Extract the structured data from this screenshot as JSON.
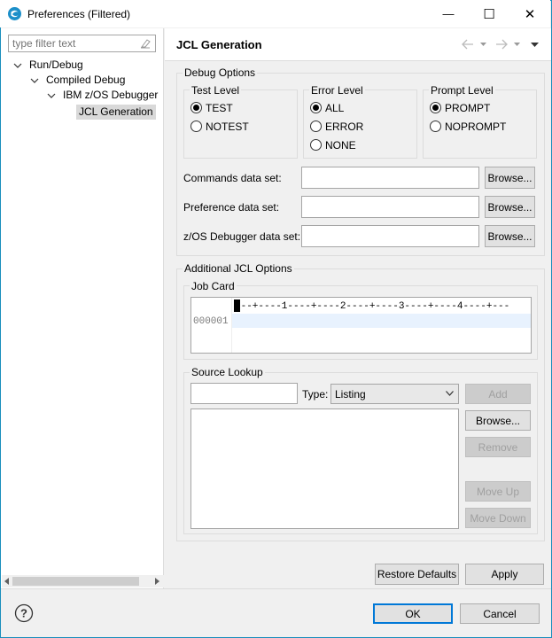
{
  "window": {
    "title": "Preferences (Filtered)",
    "minimize_glyph": "—",
    "maximize_glyph": "☐",
    "close_glyph": "✕"
  },
  "filter": {
    "placeholder": "type filter text"
  },
  "tree": [
    {
      "label": "Run/Debug",
      "expanded": true
    },
    {
      "label": "Compiled Debug",
      "expanded": true
    },
    {
      "label": "IBM z/OS Debugger",
      "expanded": true
    },
    {
      "label": "JCL Generation",
      "selected": true
    }
  ],
  "page": {
    "title": "JCL Generation"
  },
  "debug_options": {
    "title": "Debug Options",
    "test_level": {
      "title": "Test Level",
      "options": [
        "TEST",
        "NOTEST"
      ],
      "selected": "TEST"
    },
    "error_level": {
      "title": "Error Level",
      "options": [
        "ALL",
        "ERROR",
        "NONE"
      ],
      "selected": "ALL"
    },
    "prompt_level": {
      "title": "Prompt Level",
      "options": [
        "PROMPT",
        "NOPROMPT"
      ],
      "selected": "PROMPT"
    },
    "commands_label": "Commands data set:",
    "preference_label": "Preference data set:",
    "zos_label": "z/OS Debugger data set:",
    "commands_value": "",
    "preference_value": "",
    "zos_value": "",
    "browse_label": "Browse..."
  },
  "additional": {
    "title": "Additional JCL Options",
    "job_card": {
      "title": "Job Card",
      "ruler": "/--+----1----+----2----+----3----+----4----+---",
      "line_number": "000001"
    },
    "source_lookup": {
      "title": "Source Lookup",
      "input_value": "",
      "type_label": "Type:",
      "type_value": "Listing",
      "add_label": "Add",
      "browse_label": "Browse...",
      "remove_label": "Remove",
      "move_up_label": "Move Up",
      "move_down_label": "Move Down"
    }
  },
  "buttons": {
    "restore_defaults": "Restore Defaults",
    "apply": "Apply",
    "ok": "OK",
    "cancel": "Cancel"
  },
  "colors": {
    "window_border": "#1a8fbd",
    "default_button_border": "#0078d7",
    "selection": "#d9d9d9"
  }
}
